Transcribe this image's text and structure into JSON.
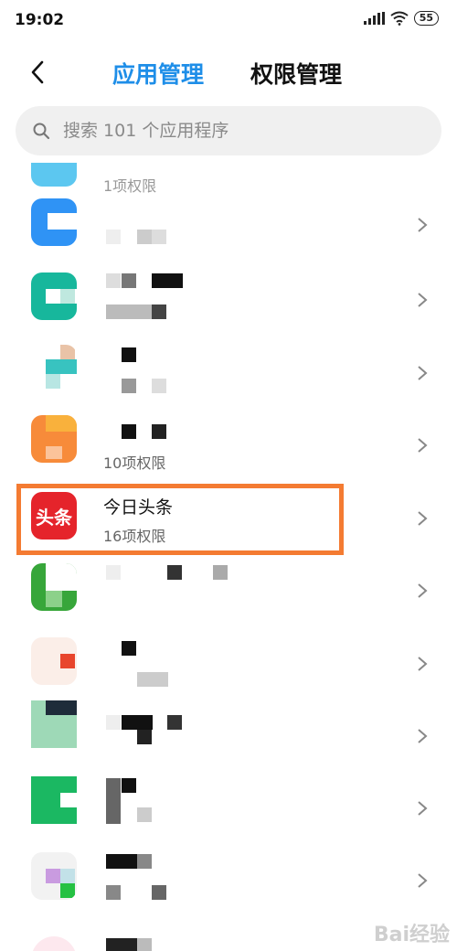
{
  "status_bar": {
    "time": "19:02",
    "battery": "55"
  },
  "header": {
    "tabs": [
      {
        "label": "应用管理",
        "active": true
      },
      {
        "label": "权限管理",
        "active": false
      }
    ]
  },
  "search": {
    "placeholder": "搜索 101 个应用程序"
  },
  "list": {
    "partial_top_perm": "1项权限",
    "items": [
      {
        "name": "",
        "perm": ""
      },
      {
        "name": "",
        "perm": ""
      },
      {
        "name": "",
        "perm": ""
      },
      {
        "name": "",
        "perm": "10项权限"
      },
      {
        "name": "今日头条",
        "perm": "16项权限",
        "icon_text": "头条",
        "highlighted": true
      },
      {
        "name": "",
        "perm": ""
      },
      {
        "name": "",
        "perm": ""
      },
      {
        "name": "",
        "perm": ""
      },
      {
        "name": "",
        "perm": ""
      },
      {
        "name": "",
        "perm": ""
      }
    ]
  },
  "colors": {
    "accent": "#1e8ee8",
    "highlight_border": "#f47b32",
    "toutiao_red": "#e5242b"
  },
  "watermark": "Bai经验"
}
